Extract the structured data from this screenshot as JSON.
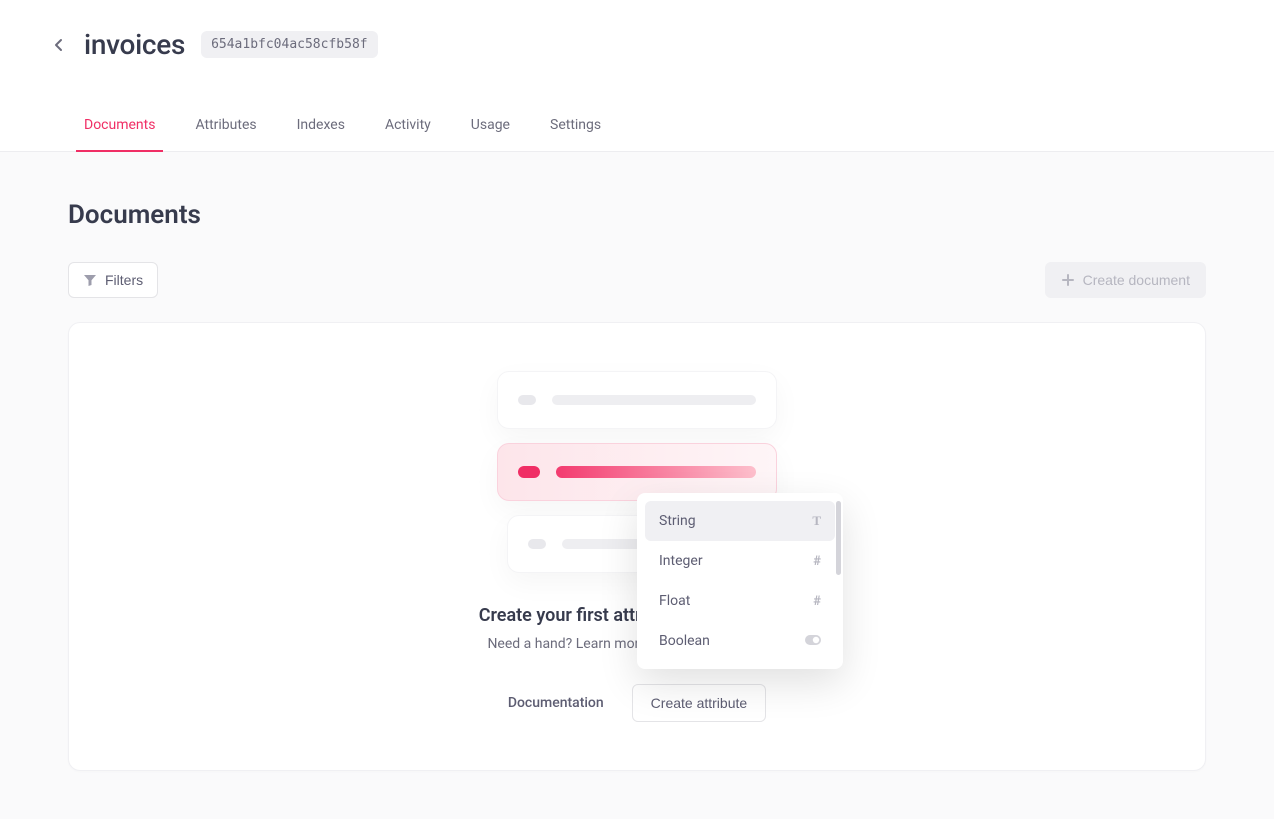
{
  "header": {
    "title": "invoices",
    "id": "654a1bfc04ac58cfb58f"
  },
  "tabs": [
    {
      "label": "Documents",
      "active": true
    },
    {
      "label": "Attributes",
      "active": false
    },
    {
      "label": "Indexes",
      "active": false
    },
    {
      "label": "Activity",
      "active": false
    },
    {
      "label": "Usage",
      "active": false
    },
    {
      "label": "Settings",
      "active": false
    }
  ],
  "section": {
    "title": "Documents"
  },
  "toolbar": {
    "filters_label": "Filters",
    "create_document_label": "Create document"
  },
  "empty_state": {
    "title": "Create your first attribute to get started",
    "subtitle": "Need a hand? Learn more in our documentation.",
    "documentation_label": "Documentation",
    "create_attribute_label": "Create attribute"
  },
  "attribute_dropdown": {
    "items": [
      {
        "label": "String",
        "icon": "T",
        "hover": true
      },
      {
        "label": "Integer",
        "icon": "#",
        "hover": false
      },
      {
        "label": "Float",
        "icon": "#",
        "hover": false
      },
      {
        "label": "Boolean",
        "icon": "⏺",
        "hover": false
      }
    ]
  }
}
